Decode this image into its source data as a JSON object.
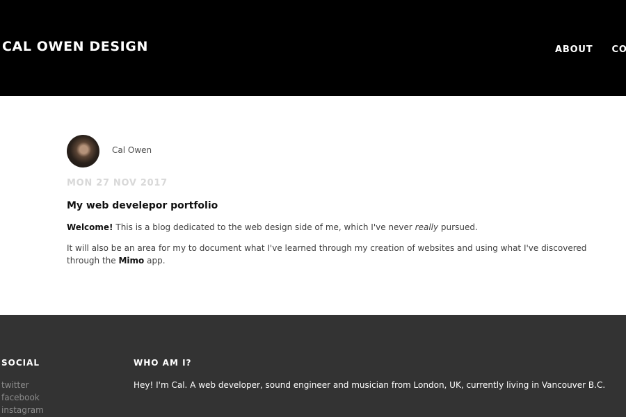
{
  "header": {
    "brand": "CAL OWEN DESIGN",
    "nav": [
      "ABOUT",
      "CONTACT"
    ]
  },
  "post": {
    "avatar_alt": "Cal Owen avatar",
    "author": "Cal Owen",
    "date": "MON 27 NOV 2017",
    "title": "My web develepor portfolio",
    "p1_bold": "Welcome!",
    "p1_text_a": " This is a blog dedicated to the web design side of me, which I've never ",
    "p1_italic": "really",
    "p1_text_b": " pursued.",
    "p2_text_a": "It will also be an area for my to document what I've learned through my creation of websites and using what I've discovered through the ",
    "p2_bold": "Mimo",
    "p2_text_b": " app."
  },
  "footer": {
    "social_heading": "SOCIAL",
    "social_links": [
      "twitter",
      "facebook",
      "instagram"
    ],
    "who_heading": "WHO AM I?",
    "who_text": "Hey! I'm Cal. A web developer, sound engineer and musician from London, UK, currently living in Vancouver B.C."
  },
  "colors": {
    "header_bg": "#000000",
    "footer_bg": "#333333",
    "date": "#d8d8d8",
    "social_link": "#8d8d8d"
  }
}
